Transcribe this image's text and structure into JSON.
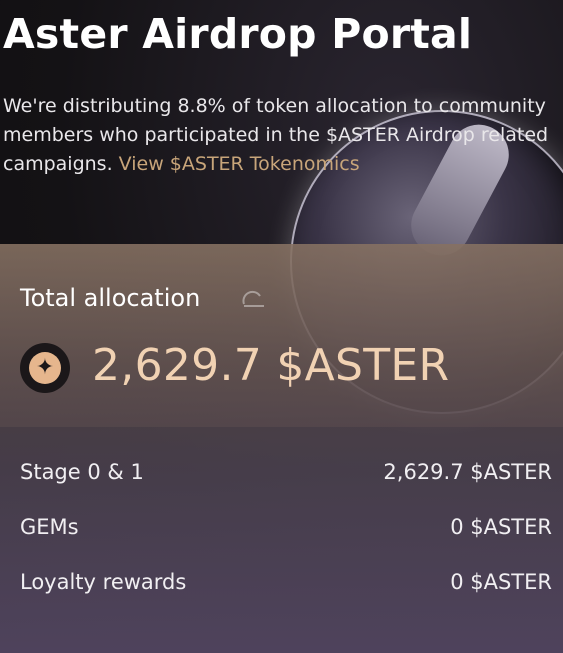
{
  "header": {
    "title": "Aster Airdrop Portal",
    "description": "We're distributing 8.8% of token allocation to community members who participated in the $ASTER Airdrop related campaigns. ",
    "tokenomics_link": "View $ASTER Tokenomics"
  },
  "allocation": {
    "label": "Total allocation",
    "value": "2,629.7 $ASTER",
    "rows": [
      {
        "label": "Stage 0 & 1",
        "value": "2,629.7 $ASTER"
      },
      {
        "label": "GEMs",
        "value": "0 $ASTER"
      },
      {
        "label": "Loyalty rewards",
        "value": "0 $ASTER"
      }
    ]
  },
  "icons": {
    "token_logo": "aster-logo-icon",
    "refresh": "refresh-icon"
  },
  "colors": {
    "accent": "#c8a57a",
    "value_highlight": "#f1d2b3"
  }
}
